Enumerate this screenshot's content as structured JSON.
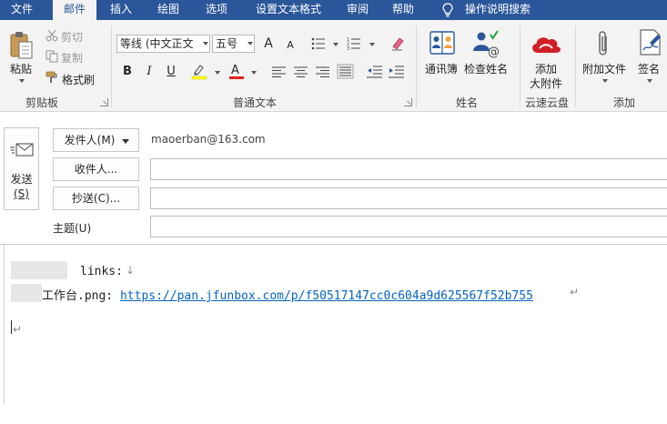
{
  "tabs": [
    {
      "label": "文件",
      "active": false
    },
    {
      "label": "邮件",
      "active": true
    },
    {
      "label": "插入",
      "active": false
    },
    {
      "label": "绘图",
      "active": false
    },
    {
      "label": "选项",
      "active": false
    },
    {
      "label": "设置文本格式",
      "active": false
    },
    {
      "label": "审阅",
      "active": false
    },
    {
      "label": "帮助",
      "active": false
    }
  ],
  "tell_me": "操作说明搜索",
  "clipboard": {
    "paste": "粘贴",
    "cut": "剪切",
    "copy": "复制",
    "format_painter": "格式刷",
    "group": "剪贴板"
  },
  "basic_text": {
    "font_name": "等线 (中文正文",
    "font_size": "五号",
    "grow": "A",
    "shrink": "A",
    "bold": "B",
    "italic": "I",
    "underline": "U",
    "group": "普通文本"
  },
  "names": {
    "address_book": "通讯簿",
    "check_names": "检查姓名",
    "group": "姓名"
  },
  "cloud": {
    "attach_big_line1": "添加",
    "attach_big_line2": "大附件",
    "group": "云速云盘"
  },
  "include": {
    "attach_file": "附加文件",
    "signature": "签名",
    "group": "添加"
  },
  "header": {
    "send_label": "发送",
    "send_key": "(S)",
    "from_button": "发件人(M)",
    "from_address": "maoerban@163.com",
    "to_button": "收件人...",
    "cc_button": "抄送(C)...",
    "subject_label": "主题(U)",
    "to_value": "",
    "cc_value": "",
    "subject_value": ""
  },
  "body": {
    "line1_text": "links:",
    "line2_prefix": "工作台.png: ",
    "line2_link": "https://pan.jfunbox.com/p/f50517147cc0c604a9d625567f52b755"
  },
  "colors": {
    "ribbon_tab_bg": "#2b579a",
    "ribbon_bg": "#f3f3f3",
    "link": "#0563c1",
    "highlight": "#ffff00",
    "font_color": "#e3241b",
    "cloud_red": "#d11f26"
  },
  "icons": [
    "clipboard-icon",
    "scissors-icon",
    "copy-icon",
    "format-painter-icon",
    "bullets-icon",
    "numbering-icon",
    "clear-format-icon",
    "highlight-icon",
    "font-color-icon",
    "align-left-icon",
    "align-center-icon",
    "align-right-icon",
    "justify-icon",
    "outdent-icon",
    "indent-icon",
    "address-book-icon",
    "check-names-icon",
    "cloud-icon",
    "paperclip-icon",
    "signature-icon",
    "lightbulb-icon",
    "send-icon",
    "dropdown-arrow-icon"
  ]
}
